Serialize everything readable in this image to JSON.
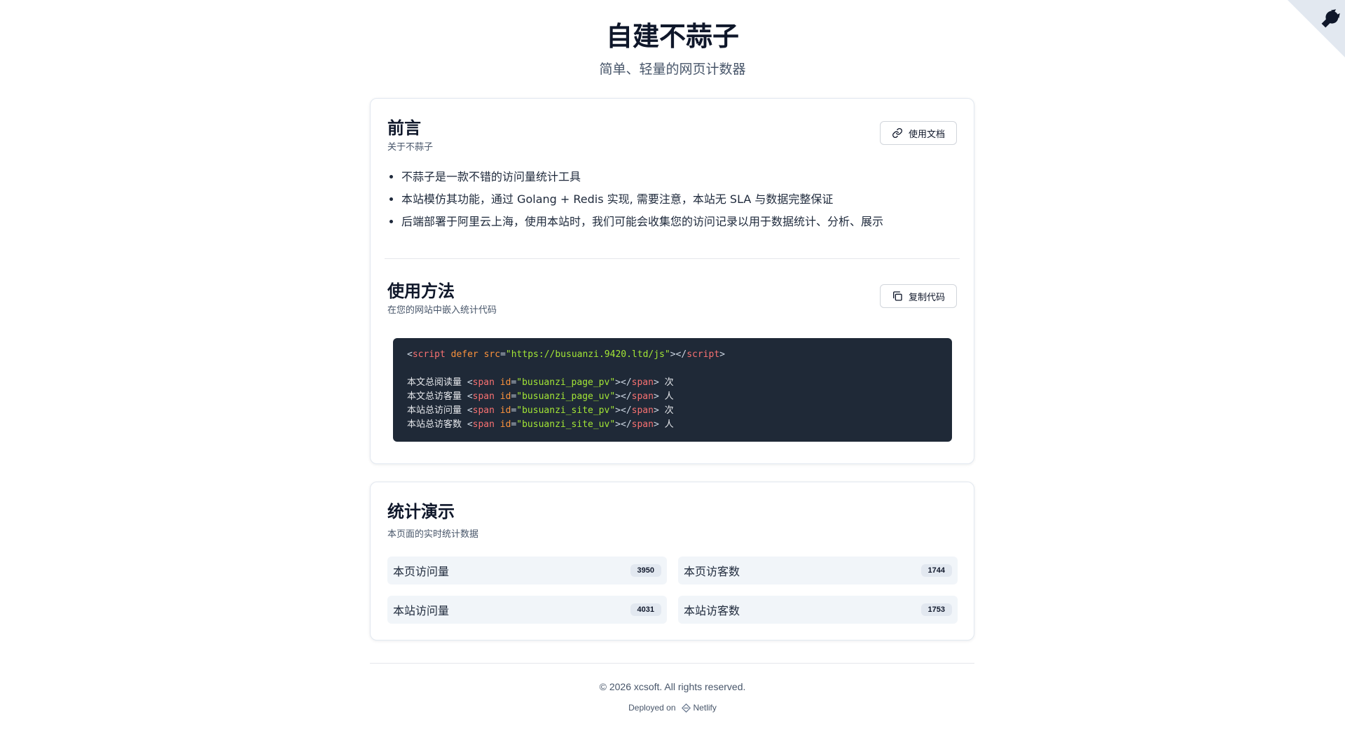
{
  "header": {
    "title": "自建不蒜子",
    "subtitle": "简单、轻量的网页计数器"
  },
  "intro": {
    "title": "前言",
    "subtitle": "关于不蒜子",
    "docs_button": "使用文档",
    "bullets": [
      "不蒜子是一款不错的访问量统计工具",
      "本站模仿其功能，通过 Golang + Redis 实现, 需要注意，本站无 SLA 与数据完整保证",
      "后端部署于阿里云上海，使用本站时，我们可能会收集您的访问记录以用于数据统计、分析、展示"
    ]
  },
  "usage": {
    "title": "使用方法",
    "subtitle": "在您的网站中嵌入统计代码",
    "copy_button": "复制代码",
    "script_src": "\"https://busuanzi.9420.ltd/js\"",
    "lines": [
      {
        "prefix": "本文总阅读量 ",
        "id": "\"busuanzi_page_pv\"",
        "suffix": " 次"
      },
      {
        "prefix": "本文总访客量 ",
        "id": "\"busuanzi_page_uv\"",
        "suffix": " 人"
      },
      {
        "prefix": "本站总访问量 ",
        "id": "\"busuanzi_site_pv\"",
        "suffix": " 次"
      },
      {
        "prefix": "本站总访客数 ",
        "id": "\"busuanzi_site_uv\"",
        "suffix": " 人"
      }
    ]
  },
  "stats": {
    "title": "统计演示",
    "subtitle": "本页面的实时统计数据",
    "items": [
      {
        "label": "本页访问量",
        "value": "3950"
      },
      {
        "label": "本页访客数",
        "value": "1744"
      },
      {
        "label": "本站访问量",
        "value": "4031"
      },
      {
        "label": "本站访客数",
        "value": "1753"
      }
    ]
  },
  "footer": {
    "copyright": "© 2026 xcsoft. All rights reserved.",
    "deployed_on": "Deployed on",
    "netlify": "Netlify"
  },
  "icons": {
    "corner": "github-octocat-icon",
    "docs": "link-icon",
    "copy": "copy-icon",
    "netlify": "netlify-icon"
  },
  "colors": {
    "code_bg": "#1f2937",
    "tag": "#f87171",
    "attr": "#fb923c",
    "string": "#a3e635"
  }
}
